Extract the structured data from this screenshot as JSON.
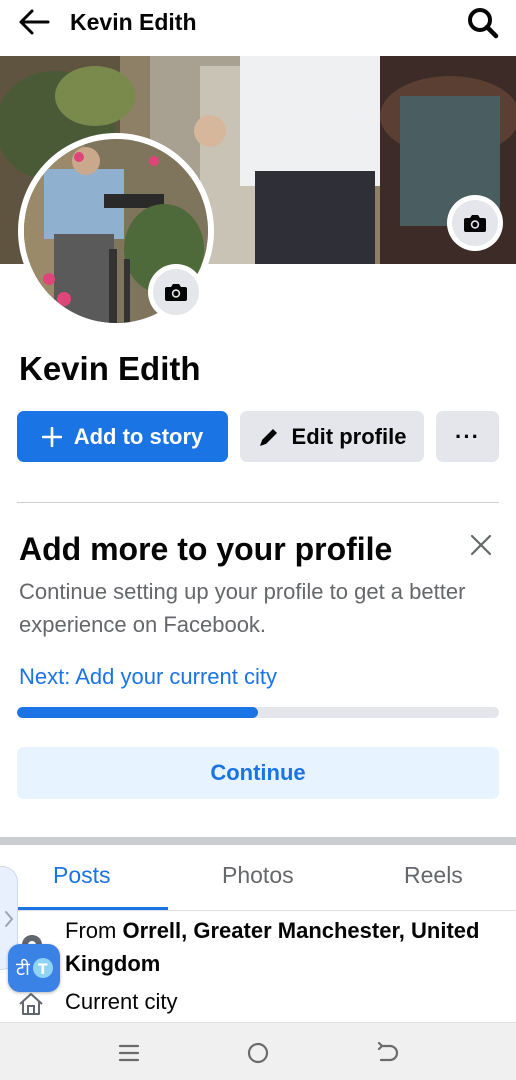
{
  "header": {
    "title": "Kevin Edith"
  },
  "profile": {
    "name": "Kevin Edith"
  },
  "actions": {
    "add_to_story": "Add to story",
    "edit_profile": "Edit profile",
    "more": "···"
  },
  "card": {
    "title": "Add more to your profile",
    "description": "Continue setting up your profile to get a better experience on Facebook.",
    "next_link": "Next: Add your current city",
    "progress": 0.5,
    "continue_label": "Continue"
  },
  "tabs": [
    {
      "label": "Posts",
      "active": true
    },
    {
      "label": "Photos",
      "active": false
    },
    {
      "label": "Reels",
      "active": false
    }
  ],
  "intro": {
    "from_prefix": "From",
    "from_place": "Orrell, Greater Manchester, United Kingdom",
    "current_city": "Current city"
  },
  "colors": {
    "accent": "#1b74e4",
    "button_gray": "#e4e6eb",
    "muted_text": "#65676b"
  },
  "icons": {
    "back": "arrow-left-icon",
    "search": "search-icon",
    "camera": "camera-icon",
    "plus": "plus-icon",
    "pencil": "pencil-icon",
    "close": "close-icon",
    "pin": "location-pin-icon",
    "home": "home-icon",
    "translate": "translate-icon"
  }
}
